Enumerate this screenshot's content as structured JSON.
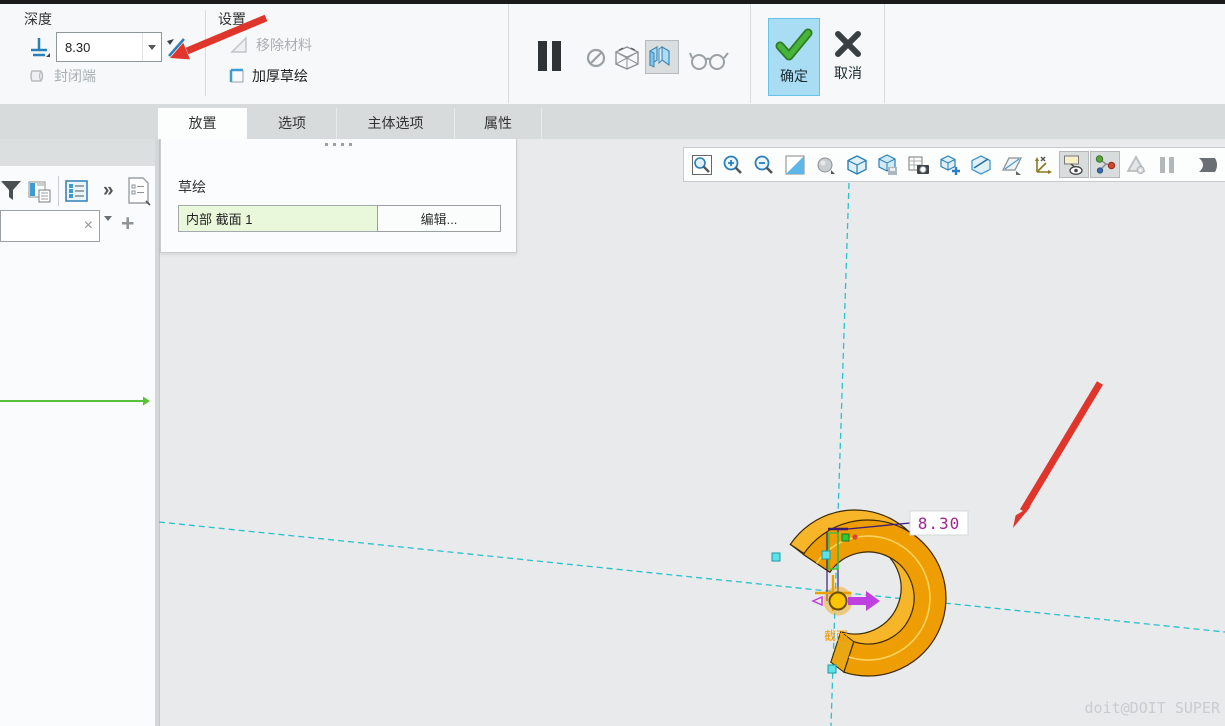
{
  "ribbon": {
    "depth": {
      "label": "深度",
      "value": "8.30",
      "capped_ends": "封闭端"
    },
    "settings": {
      "label": "设置",
      "remove_material": "移除材料",
      "thicken_sketch": "加厚草绘"
    },
    "preview_icons": [
      "pause-icon",
      "no-preview-icon",
      "wireframe-preview-icon",
      "shaded-preview-icon",
      "glasses-icon"
    ],
    "actions": {
      "ok": "确定",
      "cancel": "取消"
    }
  },
  "tabs": [
    {
      "label": "放置",
      "active": true
    },
    {
      "label": "选项",
      "active": false
    },
    {
      "label": "主体选项",
      "active": false
    },
    {
      "label": "属性",
      "active": false
    }
  ],
  "placement_panel": {
    "sketch_label": "草绘",
    "sketch_value": "内部 截面 1",
    "edit_button": "编辑..."
  },
  "left_panel": {
    "icons": [
      "filter-icon",
      "model-tree-columns-icon",
      "tree-list-icon",
      "chevrons-icon",
      "tree-settings-doc-icon"
    ],
    "chevrons_glyph": "»",
    "search": {
      "value": "",
      "clear_glyph": "×"
    },
    "plus_glyph": "+"
  },
  "graphics_toolbar": {
    "icons": [
      "zoom-refit-icon",
      "zoom-in-icon",
      "zoom-out-icon",
      "repaint-icon",
      "shading-style-icon",
      "display-style-icon",
      "saved-orientations-icon",
      "capture-image-icon",
      "view-manager-icon",
      "section-icon",
      "plane-display-icon",
      "axis-display-icon",
      "annotation-display-icon",
      "spin-center-icon",
      "perspective-icon",
      "pause-icon",
      "clipped-icon"
    ],
    "pressed": [
      "annotation-display-icon",
      "spin-center-icon"
    ]
  },
  "viewport": {
    "dimension": "8.30",
    "section_label": "截面",
    "watermark": "doit@DOIT SUPER"
  },
  "colors": {
    "model_orange_front": "#ee9e03",
    "model_orange_top": "#f7b62a",
    "dash_cyan": "#2ac1cc",
    "dimension_magenta": "#a2268f",
    "leader_indigo": "#3b1a78",
    "drag_arrow_magenta": "#c03fe0",
    "annotation_red": "#e0352b",
    "ok_blue": "#a9ddf3",
    "check_green": "#3aa52f",
    "highlight_green": "#58c23a"
  }
}
